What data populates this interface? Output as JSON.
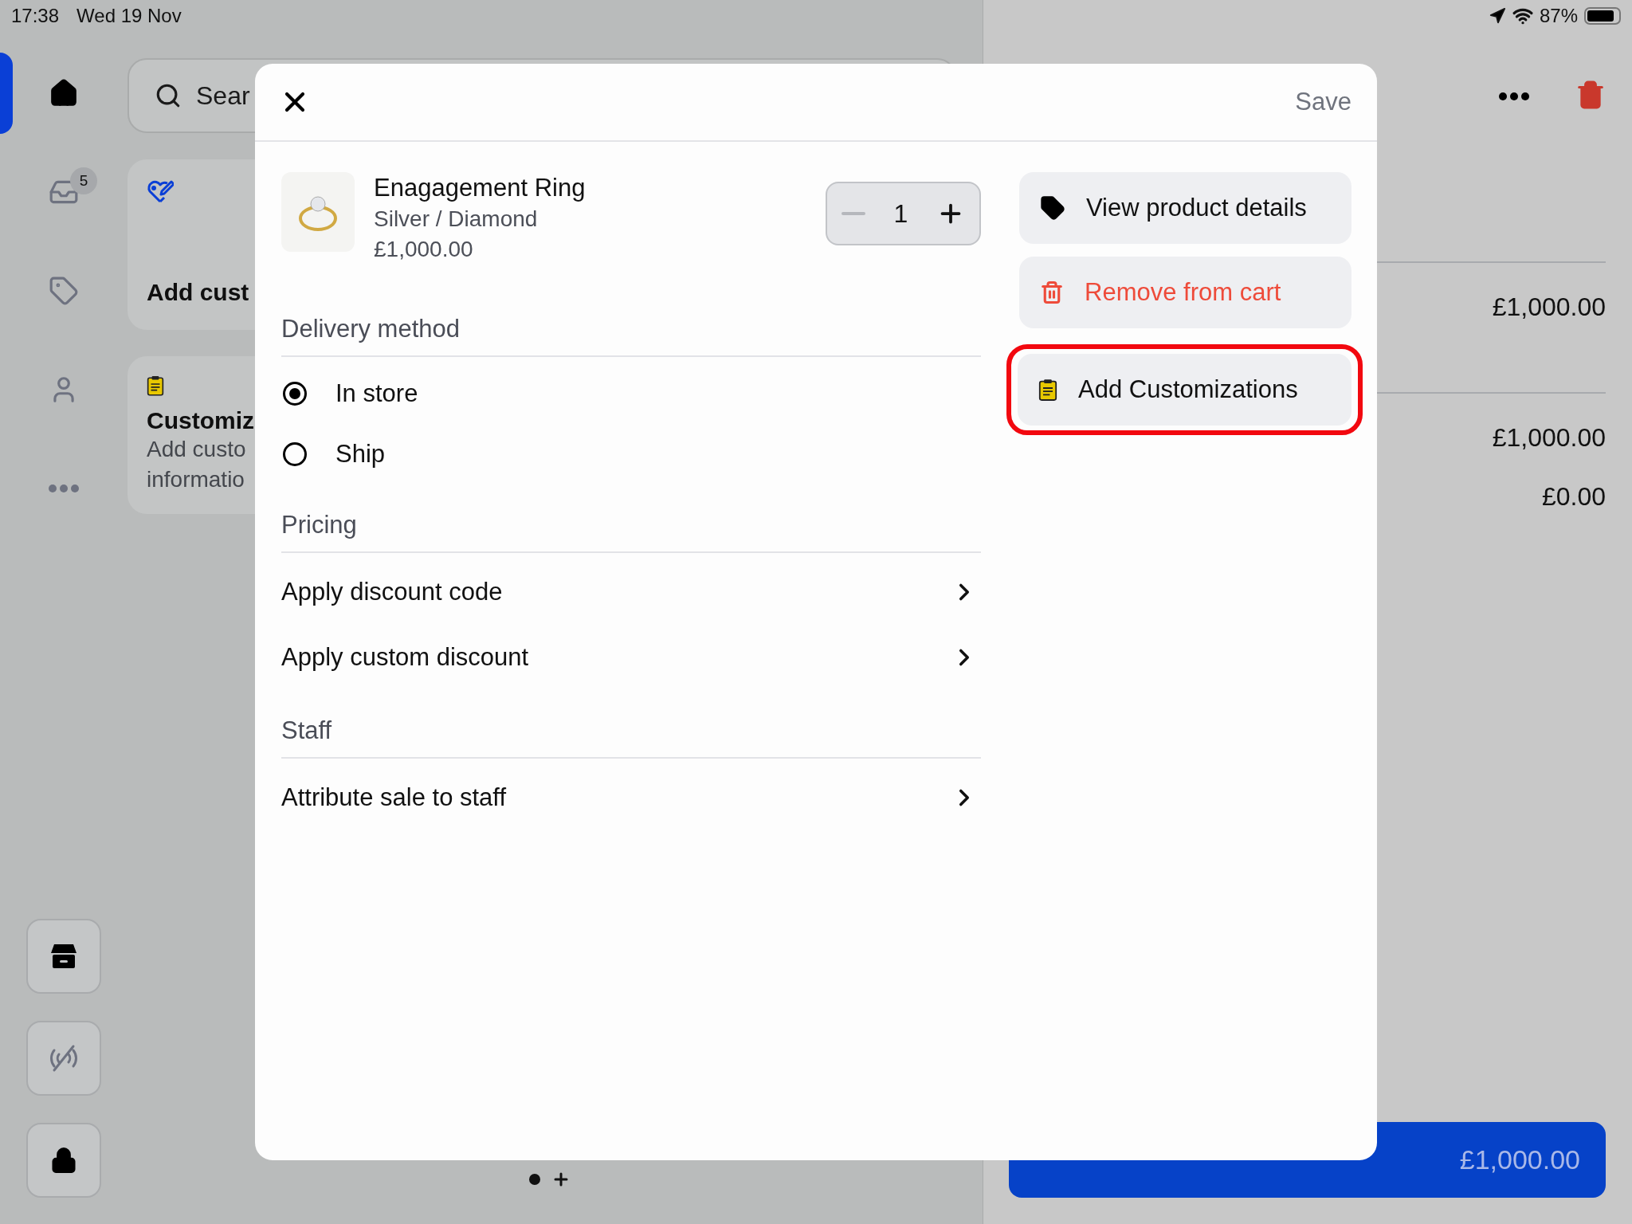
{
  "status_bar": {
    "time": "17:38",
    "date": "Wed 19 Nov",
    "battery": "87%"
  },
  "rail": {
    "items": [
      {
        "kind": "home",
        "selected": true
      },
      {
        "kind": "inbox",
        "selected": false,
        "badge": "5"
      },
      {
        "kind": "tag",
        "selected": false
      },
      {
        "kind": "person",
        "selected": false
      },
      {
        "kind": "more",
        "selected": false
      }
    ],
    "bottom_buttons": [
      {
        "kind": "store"
      },
      {
        "kind": "signal-off"
      },
      {
        "kind": "lock"
      }
    ]
  },
  "search": {
    "placeholder": "Sear"
  },
  "cards": [
    {
      "kind": "customer",
      "title": "Add cust"
    },
    {
      "kind": "customization",
      "title": "Customiz",
      "lines": [
        "Add custo",
        "informatio"
      ]
    }
  ],
  "cart": {
    "rows": [
      {
        "amount": "£1,000.00",
        "divider": true
      },
      {
        "amount": "£1,000.00",
        "divider": true
      },
      {
        "amount": "£0.00",
        "divider": false
      }
    ],
    "checkout": {
      "total": "£1,000.00"
    }
  },
  "modal": {
    "save": "Save",
    "product": {
      "name": "Enagagement Ring",
      "variant": "Silver / Diamond",
      "price": "£1,000.00",
      "quantity": "1"
    },
    "sections": [
      {
        "title": "Delivery method",
        "kind": "radio",
        "options": [
          {
            "label": "In store",
            "selected": true
          },
          {
            "label": "Ship",
            "selected": false
          }
        ]
      },
      {
        "title": "Pricing",
        "kind": "links",
        "options": [
          {
            "label": "Apply discount code"
          },
          {
            "label": "Apply custom discount"
          }
        ]
      },
      {
        "title": "Staff",
        "kind": "links",
        "options": [
          {
            "label": "Attribute sale to staff"
          }
        ]
      }
    ],
    "actions": [
      {
        "kind": "details",
        "label": "View product details",
        "highlighted": false
      },
      {
        "kind": "remove",
        "label": "Remove from cart",
        "highlighted": false
      },
      {
        "kind": "customize",
        "label": "Add Customizations",
        "highlighted": true
      }
    ]
  }
}
